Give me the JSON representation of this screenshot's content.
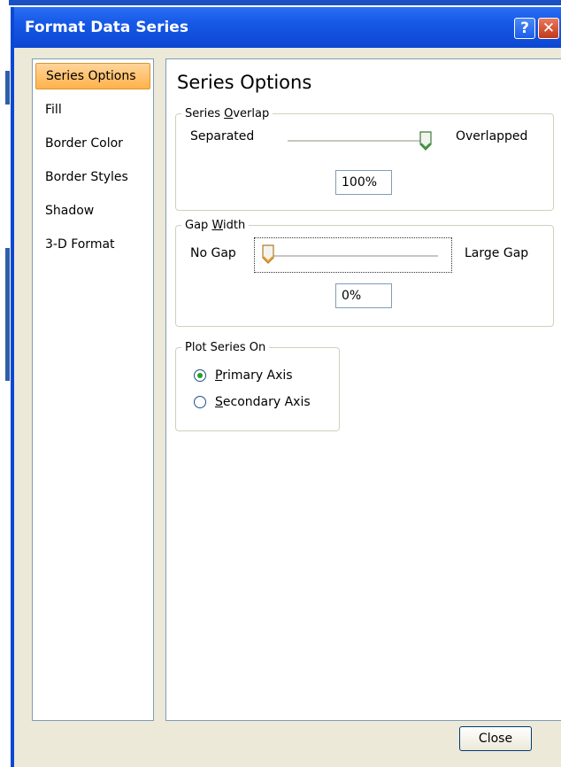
{
  "window": {
    "title": "Format Data Series",
    "help_glyph": "?",
    "close_glyph": "✕"
  },
  "nav": {
    "items": [
      {
        "label": "Series Options",
        "active": true
      },
      {
        "label": "Fill"
      },
      {
        "label": "Border Color"
      },
      {
        "label": "Border Styles"
      },
      {
        "label": "Shadow"
      },
      {
        "label": "3-D Format"
      }
    ]
  },
  "panel": {
    "title": "Series Options",
    "series_overlap": {
      "legend_pre": "Series ",
      "legend_u": "O",
      "legend_post": "verlap",
      "left_label": "Separated",
      "right_label": "Overlapped",
      "value_text": "100%",
      "level": 1.0
    },
    "gap_width": {
      "legend_pre": "Gap ",
      "legend_u": "W",
      "legend_post": "idth",
      "left_label": "No Gap",
      "right_label": "Large Gap",
      "value_text": "0%",
      "level": 0.0
    },
    "plot_series_on": {
      "legend": "Plot Series On",
      "primary": {
        "u": "P",
        "rest": "rimary Axis",
        "checked": true
      },
      "secondary": {
        "u": "S",
        "rest": "econdary Axis",
        "checked": false
      }
    }
  },
  "footer": {
    "close_label": "Close"
  },
  "colors": {
    "titlebar": "#0c47d2",
    "active_nav": "#ffb24a",
    "radio_dot": "#21a121"
  }
}
